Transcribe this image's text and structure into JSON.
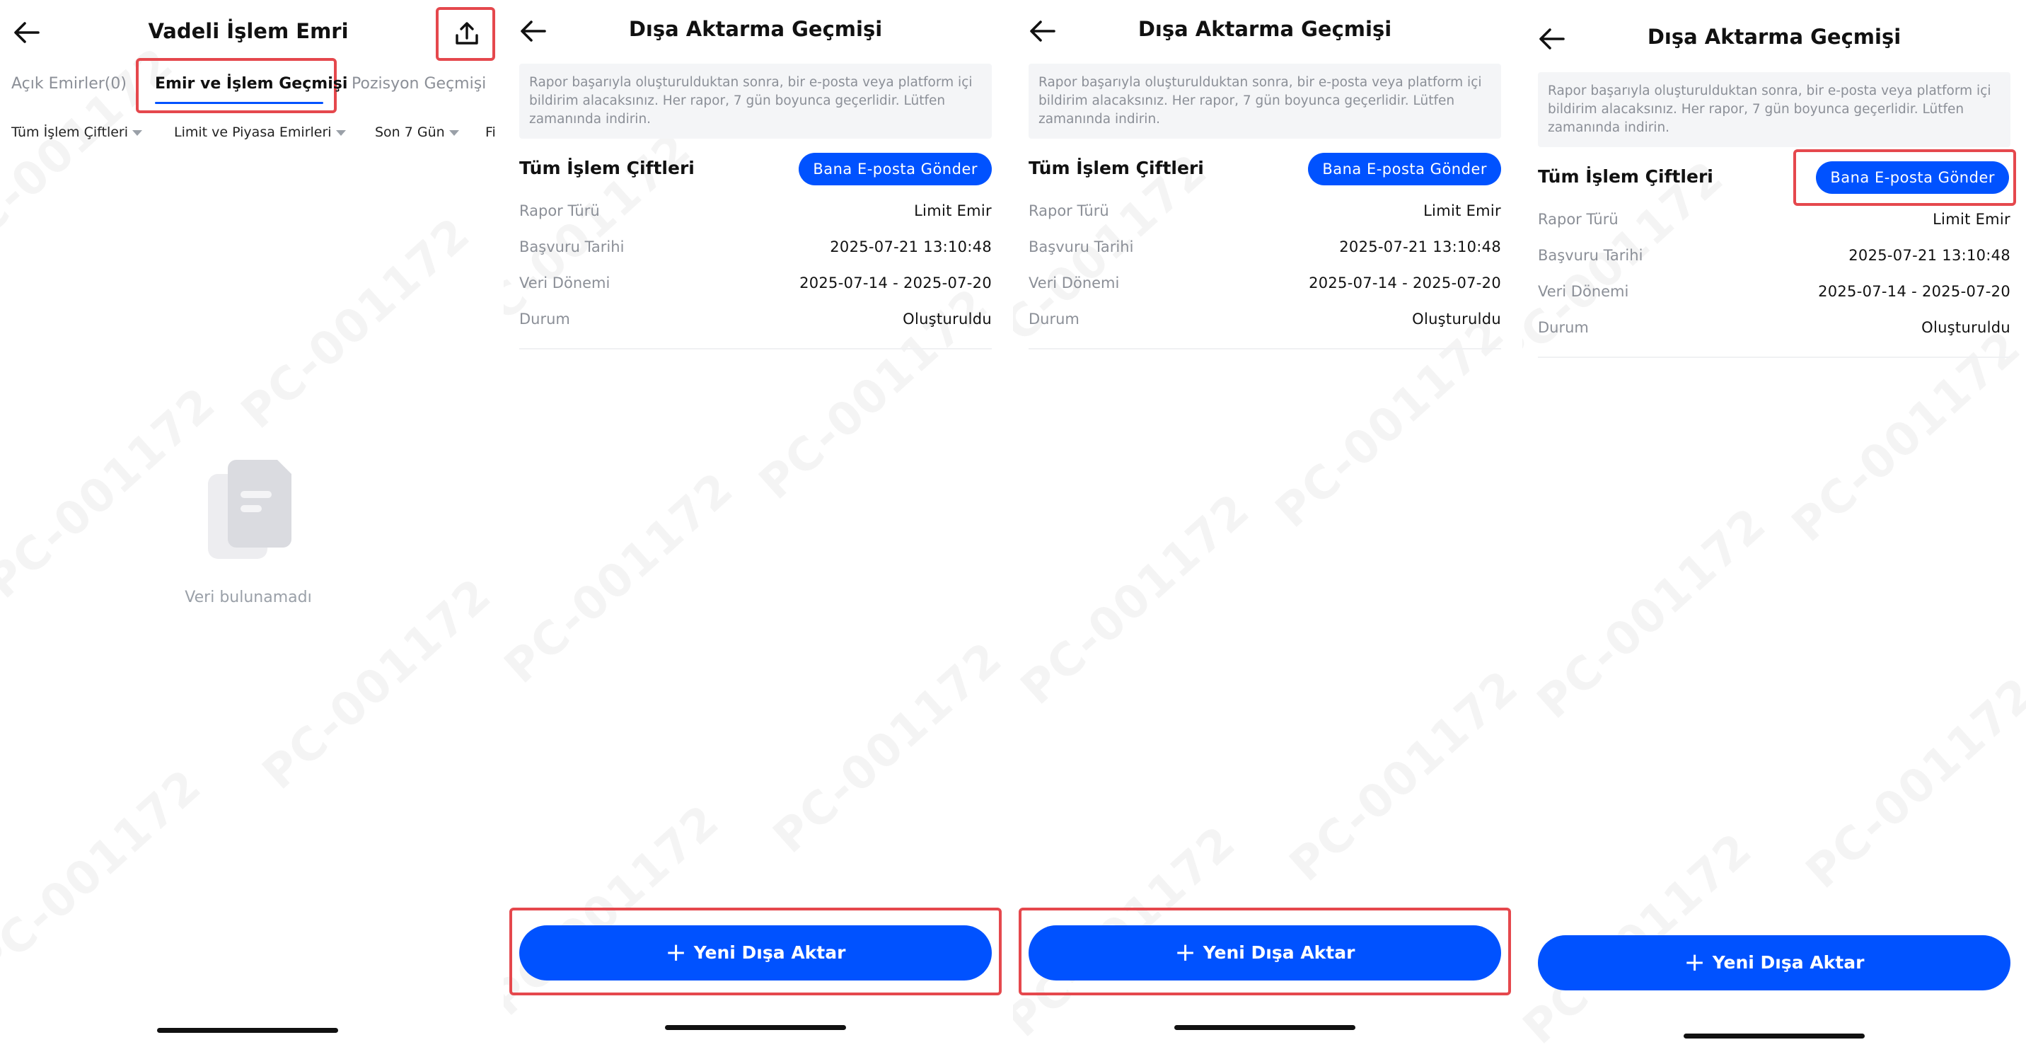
{
  "watermark": "PC-001172",
  "orders_screen": {
    "title": "Vadeli İşlem Emri",
    "tabs": [
      "Açık Emirler(0)",
      "Emir ve İşlem Geçmişi",
      "Pozisyon Geçmişi"
    ],
    "active_tab": 1,
    "filters": [
      "Tüm İşlem Çiftleri",
      "Limit ve Piyasa Emirleri",
      "Son 7 Gün",
      "Fil"
    ],
    "empty_text": "Veri bulunamadı"
  },
  "export_screen": {
    "title": "Dışa Aktarma Geçmişi",
    "notice": "Rapor başarıyla oluşturulduktan sonra, bir e-posta veya platform içi bildirim alacaksınız. Her rapor, 7 gün boyunca geçerlidir. Lütfen zamanında indirin.",
    "pairs_label": "Tüm İşlem Çiftleri",
    "email_button": "Bana E-posta Gönder",
    "rows": [
      {
        "label": "Rapor Türü",
        "value": "Limit Emir"
      },
      {
        "label": "Başvuru Tarihi",
        "value": "2025-07-21 13:10:48"
      },
      {
        "label": "Veri Dönemi",
        "value": "2025-07-14 - 2025-07-20"
      },
      {
        "label": "Durum",
        "value": "Oluşturuldu"
      }
    ],
    "new_export_button": "Yeni Dışa Aktar"
  },
  "colors": {
    "accent": "#0052ff",
    "highlight": "#e5484d",
    "muted": "#8b8f97"
  }
}
